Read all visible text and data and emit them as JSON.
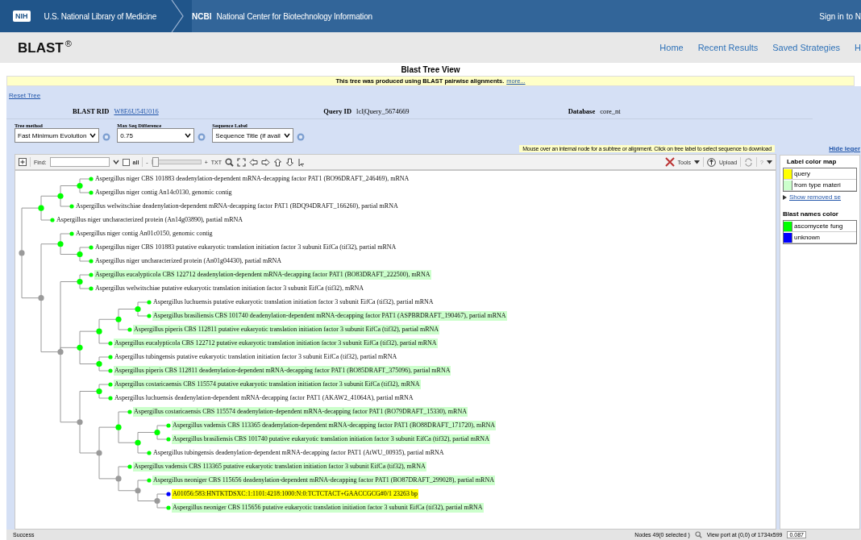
{
  "header": {
    "logo": "NIH",
    "org": "U.S. National Library of Medicine",
    "brand": "NCBI",
    "center": "National Center for Biotechnology Information",
    "sign_in": "Sign in to N"
  },
  "app_bar": {
    "title": "BLAST",
    "title_mark": "®",
    "nav": [
      "Home",
      "Recent Results",
      "Saved Strategies",
      "H"
    ]
  },
  "page_title": "Blast Tree View",
  "notice": {
    "text": "This tree was produced using BLAST pairwise alignments.",
    "link": "more..."
  },
  "reset_link": "Reset Tree",
  "info": [
    {
      "label": "BLAST RID",
      "value": "W8E6U54U016",
      "kind": "link"
    },
    {
      "label": "Query ID",
      "value": "lcl|Query_5674669",
      "kind": "text"
    },
    {
      "label": "Database",
      "value": "core_nt",
      "kind": "text"
    }
  ],
  "options": [
    {
      "label": "Tree method",
      "value": "Fast Minimum Evolution"
    },
    {
      "label": "Max Seq Difference",
      "value": "0.75"
    },
    {
      "label": "Sequence Label",
      "value": "Sequence Title (if avail"
    }
  ],
  "hint": "Mouse over an internal node for a subtree or alignment. Click on tree label to select sequence to download",
  "toolbar": {
    "find_label": "Find:",
    "all_label": "all",
    "all_checked": false,
    "zoom_out": "-",
    "zoom_in": "+",
    "zoom": {
      "level": 0
    },
    "txt": "TXT",
    "tools": "Tools",
    "upload": "Upload",
    "help": "?"
  },
  "tree": {
    "children": [
      {
        "children": [
          {
            "children": [
              {
                "children": [
                  {
                    "label": "Aspergillus niger CBS 101883 deadenylation-dependent mRNA-decapping factor PAT1 (BO96DRAFT_246469), mRNA",
                    "color": "#00ff00",
                    "kind": "plain"
                  },
                  {
                    "label": "Aspergillus niger contig An14c0130, genomic contig",
                    "color": "#00ff00",
                    "kind": "plain"
                  }
                ]
              },
              {
                "label": "Aspergillus welwitschiae deadenylation-dependent mRNA-decapping factor PAT1 (BDQ94DRAFT_166260), partial mRNA",
                "color": "#00ff00",
                "kind": "plain"
              }
            ]
          },
          {
            "label": "Aspergillus niger uncharacterized protein (An14g03890), partial mRNA",
            "color": "#00ff00",
            "kind": "plain"
          }
        ]
      },
      {
        "children": [
          {
            "children": [
              {
                "label": "Aspergillus niger contig An01c0150, genomic contig",
                "color": "#00ff00",
                "kind": "plain"
              },
              {
                "children": [
                  {
                    "label": "Aspergillus niger CBS 101883 putative eukaryotic translation initiation factor 3 subunit EifCa (tif32), partial mRNA",
                    "color": "#00ff00",
                    "kind": "plain"
                  },
                  {
                    "label": "Aspergillus niger uncharacterized protein (An01g04430), partial mRNA",
                    "color": "#00ff00",
                    "kind": "plain"
                  }
                ]
              }
            ]
          },
          {
            "children": [
              {
                "children": [
                  {
                    "label": "Aspergillus eucalypticola CBS 122712 deadenylation-dependent mRNA-decapping factor PAT1 (BO83DRAFT_222500), mRNA",
                    "color": "#00ff00",
                    "kind": "type_material"
                  },
                  {
                    "label": "Aspergillus welwitschiae putative eukaryotic translation initiation factor 3 subunit EifCa (tif32), mRNA",
                    "color": "#00ff00",
                    "kind": "plain"
                  }
                ]
              },
              {
                "children": [
                  {
                    "children": [
                      {
                        "children": [
                          {
                            "children": [
                              {
                                "label": "Aspergillus luchuensis putative eukaryotic translation initiation factor 3 subunit EifCa (tif32), partial mRNA",
                                "color": "#00ff00",
                                "kind": "plain"
                              },
                              {
                                "label": "Aspergillus brasiliensis CBS 101740 deadenylation-dependent mRNA-decapping factor PAT1 (ASPBRDRAFT_190467), partial mRNA",
                                "color": "#00ff00",
                                "kind": "type_material"
                              }
                            ]
                          },
                          {
                            "label": "Aspergillus piperis CBS 112811 putative eukaryotic translation initiation factor 3 subunit EifCa (tif32), partial mRNA",
                            "color": "#00ff00",
                            "kind": "type_material"
                          }
                        ]
                      },
                      {
                        "label": "Aspergillus eucalypticola CBS 122712 putative eukaryotic translation initiation factor 3 subunit EifCa (tif32), partial mRNA",
                        "color": "#00ff00",
                        "kind": "type_material"
                      }
                    ]
                  },
                  {
                    "children": [
                      {
                        "label": "Aspergillus tubingensis putative eukaryotic translation initiation factor 3 subunit EifCa (tif32), partial mRNA",
                        "color": "#00ff00",
                        "kind": "plain"
                      },
                      {
                        "label": "Aspergillus piperis CBS 112811 deadenylation-dependent mRNA-decapping factor PAT1 (BO85DRAFT_375096), partial mRNA",
                        "color": "#00ff00",
                        "kind": "type_material"
                      }
                    ]
                  }
                ]
              },
              {
                "children": [
                  {
                    "children": [
                      {
                        "label": "Aspergillus costaricaensis CBS 115574 putative eukaryotic translation initiation factor 3 subunit EifCa (tif32), mRNA",
                        "color": "#00ff00",
                        "kind": "type_material"
                      },
                      {
                        "label": "Aspergillus luchuensis deadenylation-dependent mRNA-decapping factor PAT1 (AKAW2_41064A), partial mRNA",
                        "color": "#00ff00",
                        "kind": "plain"
                      }
                    ]
                  },
                  {
                    "children": [
                      {
                        "children": [
                          {
                            "label": "Aspergillus costaricaensis CBS 115574 deadenylation-dependent mRNA-decapping factor PAT1 (BO79DRAFT_15330), mRNA",
                            "color": "#00ff00",
                            "kind": "type_material"
                          },
                          {
                            "children": [
                              {
                                "children": [
                                  {
                                    "label": "Aspergillus vadensis CBS 113365 deadenylation-dependent mRNA-decapping factor PAT1 (BO88DRAFT_171720), mRNA",
                                    "color": "#00ff00",
                                    "kind": "type_material"
                                  },
                                  {
                                    "label": "Aspergillus brasiliensis CBS 101740 putative eukaryotic translation initiation factor 3 subunit EifCa (tif32), partial mRNA",
                                    "color": "#00ff00",
                                    "kind": "type_material"
                                  }
                                ]
                              },
                              {
                                "label": "Aspergillus tubingensis deadenylation-dependent mRNA-decapping factor PAT1 (AtWU_00935), partial mRNA",
                                "color": "#00ff00",
                                "kind": "plain"
                              }
                            ]
                          }
                        ]
                      },
                      {
                        "children": [
                          {
                            "label": "Aspergillus vadensis CBS 113365 putative eukaryotic translation initiation factor 3 subunit EifCa (tif32), mRNA",
                            "color": "#00ff00",
                            "kind": "type_material"
                          },
                          {
                            "children": [
                              {
                                "label": "Aspergillus neoniger CBS 115656 deadenylation-dependent mRNA-decapping factor PAT1 (BO87DRAFT_299028), partial mRNA",
                                "color": "#00ff00",
                                "kind": "type_material"
                              },
                              {
                                "children": [
                                  {
                                    "label": "A01056:583:HNTKTDSXC:1:1101:4218:1000:N:0:TCTCTACT+GAACCGCG#0/1 23263 bp",
                                    "color": "#0000ff",
                                    "kind": "query"
                                  },
                                  {
                                    "label": "Aspergillus neoniger CBS 115656 putative eukaryotic translation initiation factor 3 subunit EifCa (tif32), partial mRNA",
                                    "color": "#00ff00",
                                    "kind": "type_material"
                                  }
                                ]
                              }
                            ]
                          }
                        ]
                      }
                    ]
                  }
                ]
              }
            ]
          }
        ]
      }
    ]
  },
  "legend": {
    "hide": "Hide leger",
    "label_map": {
      "title": "Label color map",
      "items": [
        {
          "name": "query",
          "color": "#ffff00"
        },
        {
          "name": "from type materi",
          "color": "#ccffcc"
        }
      ]
    },
    "show_removed": "Show removed se",
    "names_map": {
      "title": "Blast names color",
      "items": [
        {
          "name": "ascomycete fung",
          "color": "#00ff00"
        },
        {
          "name": "unknown",
          "color": "#0000ff"
        }
      ]
    }
  },
  "status_bar": {
    "message": "Success",
    "nodes": "Nodes 49(0 selected )",
    "viewport": "View port at (0,0)  of 1734x599",
    "scale": "0.087"
  }
}
